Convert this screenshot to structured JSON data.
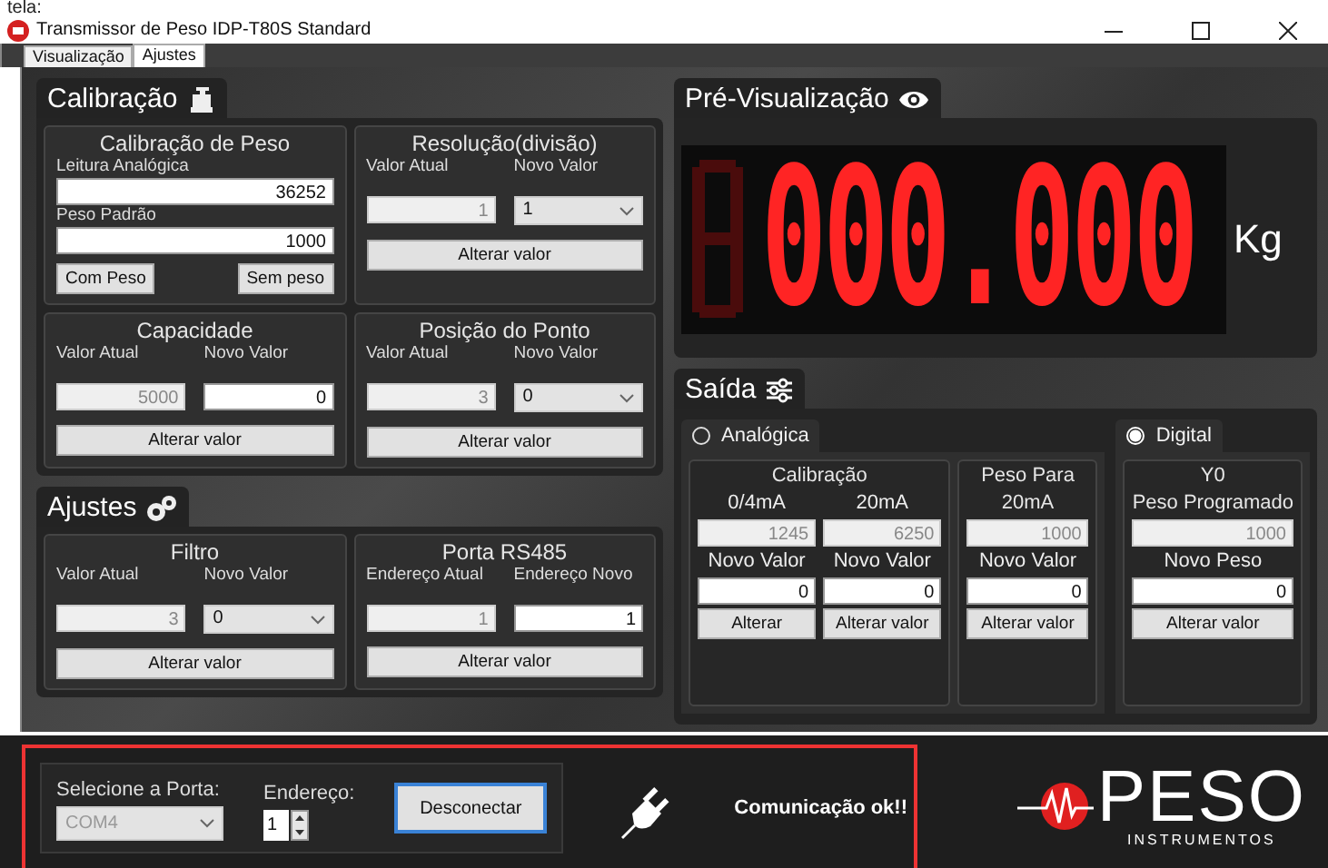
{
  "caption": "tela:",
  "window": {
    "title": "Transmissor de Peso IDP-T80S Standard"
  },
  "tabs": [
    {
      "label": "Visualização",
      "selected": false
    },
    {
      "label": "Ajustes",
      "selected": true
    }
  ],
  "calibration": {
    "title": "Calibração",
    "panels": [
      {
        "kind": "calibration",
        "title": "Calibração de Peso",
        "fields": [
          {
            "label": "Leitura Analógica",
            "value": "36252"
          },
          {
            "label": "Peso Padrão",
            "value": "1000"
          }
        ],
        "buttons": [
          "Com Peso",
          "Sem peso"
        ]
      },
      {
        "kind": "setting",
        "title": "Resolução(divisão)",
        "current_label": "Valor Atual",
        "current": "1",
        "new_label": "Novo Valor",
        "new": {
          "kind": "select",
          "value": "1"
        },
        "button": "Alterar valor"
      },
      {
        "kind": "setting",
        "title": "Capacidade",
        "current_label": "Valor Atual",
        "current": "5000",
        "new_label": "Novo Valor",
        "new": {
          "kind": "input",
          "value": "0"
        },
        "button": "Alterar valor"
      },
      {
        "kind": "setting",
        "title": "Posição do Ponto",
        "current_label": "Valor Atual",
        "current": "3",
        "new_label": "Novo Valor",
        "new": {
          "kind": "select",
          "value": "0"
        },
        "button": "Alterar valor"
      }
    ]
  },
  "settings": {
    "title": "Ajustes",
    "panels": [
      {
        "kind": "setting",
        "title": "Filtro",
        "current_label": "Valor Atual",
        "current": "3",
        "new_label": "Novo Valor",
        "new": {
          "kind": "select",
          "value": "0"
        },
        "button": "Alterar valor"
      },
      {
        "kind": "setting",
        "title": "Porta RS485",
        "current_label": "Endereço Atual",
        "current": "1",
        "new_label": "Endereço Novo",
        "new": {
          "kind": "input",
          "value": "1"
        },
        "button": "Alterar valor"
      }
    ]
  },
  "preview": {
    "title": "Pré-Visualização",
    "reading": "000.000",
    "unit": "Kg"
  },
  "output": {
    "title": "Saída",
    "modes": [
      {
        "label": "Analógica",
        "selected": false,
        "panels": [
          {
            "title": "Calibração",
            "columns": [
              {
                "label": "0/4mA",
                "current": "1245",
                "new_label": "Novo Valor",
                "new": "0",
                "button": "Alterar"
              },
              {
                "label": "20mA",
                "current": "6250",
                "new_label": "Novo Valor",
                "new": "0",
                "button": "Alterar valor"
              }
            ]
          },
          {
            "title_lines": [
              "Peso Para",
              "20mA"
            ],
            "columns": [
              {
                "current": "1000",
                "new_label": "Novo Valor",
                "new": "0",
                "button": "Alterar valor"
              }
            ]
          }
        ]
      },
      {
        "label": "Digital",
        "selected": true,
        "panels": [
          {
            "title_lines": [
              "Y0",
              "Peso Programado"
            ],
            "columns": [
              {
                "current": "1000",
                "new_label": "Novo Peso",
                "new": "0",
                "button": "Alterar valor"
              }
            ]
          }
        ]
      }
    ]
  },
  "connection": {
    "port_label": "Selecione a Porta:",
    "port": "COM4",
    "port_disabled": true,
    "address_label": "Endereço:",
    "address": "1",
    "button": "Desconectar",
    "status": "Comunicação ok!!"
  },
  "logo": {
    "name": "PESO",
    "tagline": "INSTRUMENTOS"
  }
}
